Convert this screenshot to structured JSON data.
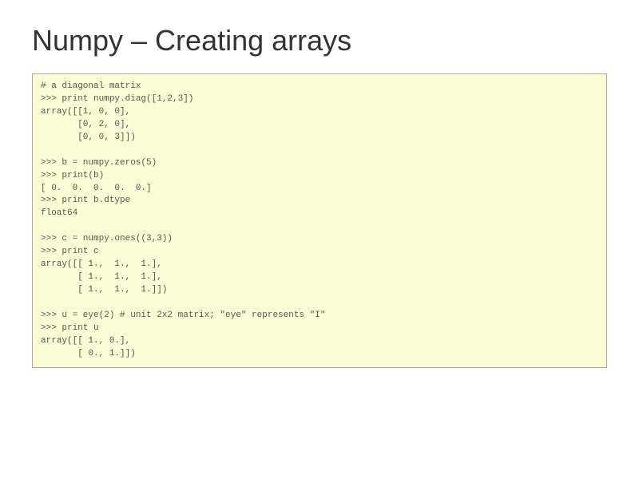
{
  "title": "Numpy – Creating arrays",
  "code": "# a diagonal matrix\n>>> print numpy.diag([1,2,3])\narray([[1, 0, 0],\n       [0, 2, 0],\n       [0, 0, 3]])\n\n>>> b = numpy.zeros(5)\n>>> print(b)\n[ 0.  0.  0.  0.  0.]\n>>> print b.dtype\nfloat64\n\n>>> c = numpy.ones((3,3))\n>>> print c\narray([[ 1.,  1.,  1.],\n       [ 1.,  1.,  1.],\n       [ 1.,  1.,  1.]])\n\n>>> u = eye(2) # unit 2x2 matrix; \"eye\" represents \"I\"\n>>> print u\narray([[ 1., 0.],\n       [ 0., 1.]])"
}
